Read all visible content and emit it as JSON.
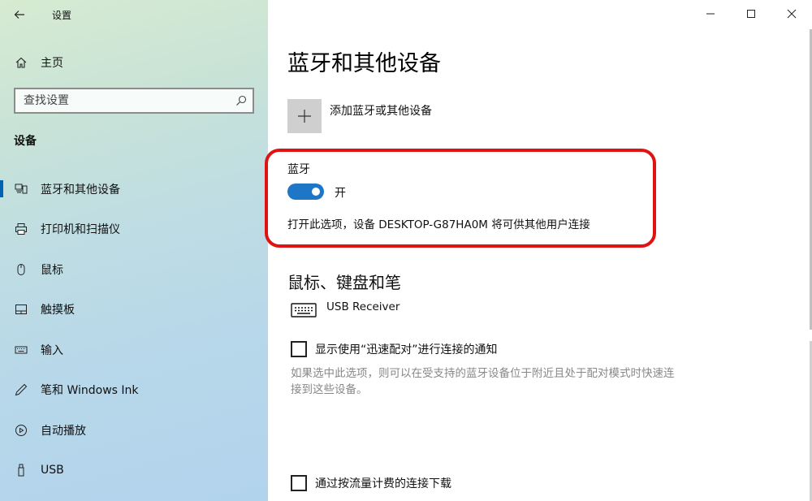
{
  "window": {
    "app_title": "设置",
    "controls": {
      "minimize": "—",
      "maximize": "☐",
      "close": "✕"
    }
  },
  "sidebar": {
    "home_label": "主页",
    "search_placeholder": "查找设置",
    "section_heading": "设备",
    "items": [
      {
        "label": "蓝牙和其他设备",
        "icon": "bluetooth-devices-icon",
        "active": true
      },
      {
        "label": "打印机和扫描仪",
        "icon": "printer-icon",
        "active": false
      },
      {
        "label": "鼠标",
        "icon": "mouse-icon",
        "active": false
      },
      {
        "label": "触摸板",
        "icon": "touchpad-icon",
        "active": false
      },
      {
        "label": "输入",
        "icon": "keyboard-icon",
        "active": false
      },
      {
        "label": "笔和 Windows Ink",
        "icon": "pen-icon",
        "active": false
      },
      {
        "label": "自动播放",
        "icon": "autoplay-icon",
        "active": false
      },
      {
        "label": "USB",
        "icon": "usb-icon",
        "active": false
      }
    ]
  },
  "main": {
    "page_title": "蓝牙和其他设备",
    "add_device_label": "添加蓝牙或其他设备",
    "bluetooth": {
      "title": "蓝牙",
      "toggle_state": "开",
      "toggle_on": true,
      "description": "打开此选项，设备 DESKTOP-G87HA0M 将可供其他用户连接"
    },
    "mouse_section": {
      "heading": "鼠标、键盘和笔",
      "device_name": "USB Receiver"
    },
    "swift_pair": {
      "label": "显示使用“迅速配对”进行连接的通知",
      "checked": false,
      "note": "如果选中此选项，则可以在受支持的蓝牙设备位于附近且处于配对模式时快速连接到这些设备。"
    },
    "metered": {
      "label": "通过按流量计费的连接下载",
      "checked": false
    }
  },
  "colors": {
    "accent": "#0063b1",
    "toggle_on": "#1d77c6",
    "highlight_box": "#e01313"
  }
}
